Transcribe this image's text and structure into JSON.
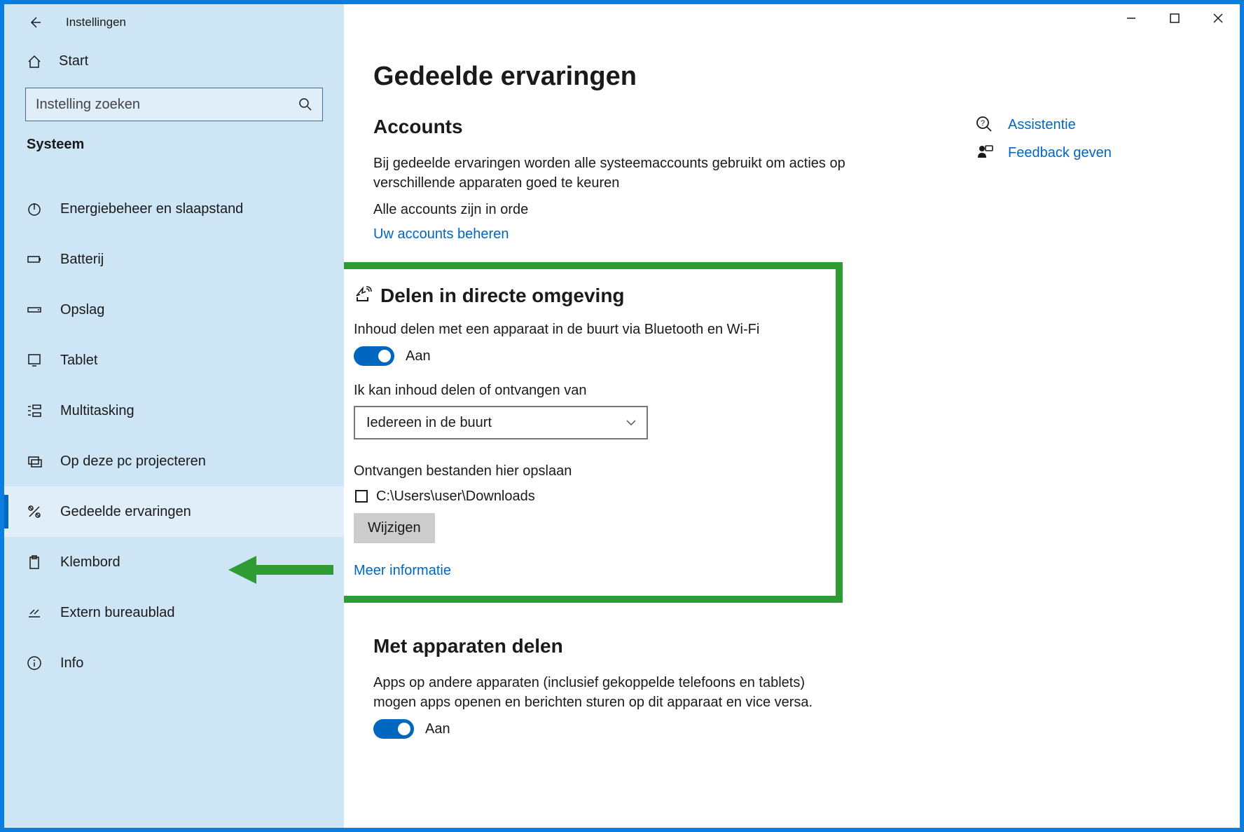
{
  "window": {
    "app_title": "Instellingen",
    "page_title": "Gedeelde ervaringen"
  },
  "sidebar": {
    "home_label": "Start",
    "search_placeholder": "Instelling zoeken",
    "category_label": "Systeem",
    "items": [
      {
        "label": "Energiebeheer en slaapstand"
      },
      {
        "label": "Batterij"
      },
      {
        "label": "Opslag"
      },
      {
        "label": "Tablet"
      },
      {
        "label": "Multitasking"
      },
      {
        "label": "Op deze pc projecteren"
      },
      {
        "label": "Gedeelde ervaringen"
      },
      {
        "label": "Klembord"
      },
      {
        "label": "Extern bureaublad"
      },
      {
        "label": "Info"
      }
    ]
  },
  "accounts": {
    "heading": "Accounts",
    "desc": "Bij gedeelde ervaringen worden alle systeemaccounts gebruikt om acties op verschillende apparaten goed te keuren",
    "status": "Alle accounts zijn in orde",
    "manage_link": "Uw accounts beheren"
  },
  "nearby": {
    "heading": "Delen in directe omgeving",
    "desc": "Inhoud delen met een apparaat in de buurt via Bluetooth en Wi-Fi",
    "toggle_label": "Aan",
    "share_from_label": "Ik kan inhoud delen of ontvangen van",
    "dropdown_value": "Iedereen in de buurt",
    "save_to_label": "Ontvangen bestanden hier opslaan",
    "save_path": "C:\\Users\\user\\Downloads",
    "change_btn": "Wijzigen",
    "more_info": "Meer informatie"
  },
  "cross_device": {
    "heading": "Met apparaten delen",
    "desc": "Apps op andere apparaten (inclusief gekoppelde telefoons en tablets) mogen apps openen en berichten sturen op dit apparaat en vice versa.",
    "toggle_label": "Aan"
  },
  "aside": {
    "help": "Assistentie",
    "feedback": "Feedback geven"
  },
  "colors": {
    "accent": "#0067c0",
    "highlight": "#2e9c33"
  }
}
